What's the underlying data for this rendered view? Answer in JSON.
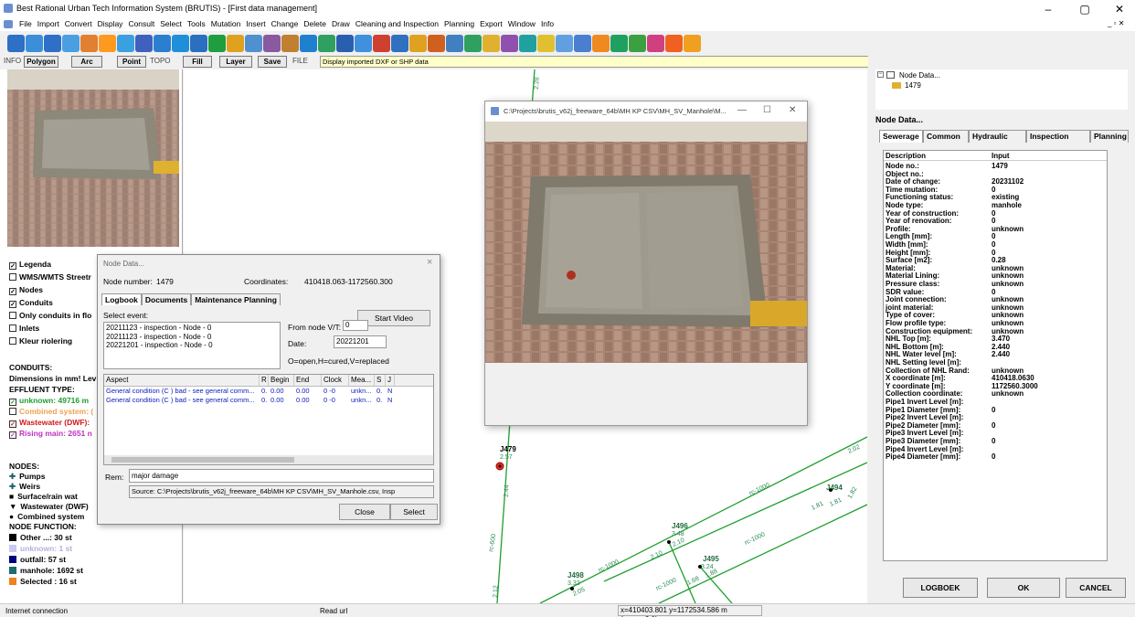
{
  "window": {
    "title": "Best Rational Urban Tech Information System (BRUTIS) - [First data management]",
    "min": "–",
    "max": "▢",
    "close": "✕"
  },
  "menu": [
    "File",
    "Import",
    "Convert",
    "Display",
    "Consult",
    "Select",
    "Tools",
    "Mutation",
    "Insert",
    "Change",
    "Delete",
    "Draw",
    "Cleaning and Inspection",
    "Planning",
    "Export",
    "Window",
    "Info"
  ],
  "toolbar2": {
    "info": "INFO",
    "polygon": "Polygon",
    "arc": "Arc",
    "point": "Point",
    "topo": "TOPO",
    "fill": "Fill",
    "layer": "Layer",
    "save": "Save",
    "file": "FILE",
    "status_text": "Display imported DXF or SHP data"
  },
  "left_panel": {
    "layers": [
      {
        "label": "Legenda",
        "checked": true
      },
      {
        "label": "WMS/WMTS Streetr",
        "checked": false
      },
      {
        "label": "Nodes",
        "checked": true
      },
      {
        "label": "Conduits",
        "checked": true
      },
      {
        "label": "Only conduits in flo",
        "checked": false
      },
      {
        "label": "Inlets",
        "checked": false
      },
      {
        "label": "Kleur riolering",
        "checked": false
      }
    ],
    "conduits_header": "CONDUITS:",
    "dims_text": "Dimensions in mm! Lev",
    "effluent_header": "EFFLUENT TYPE:",
    "effluent": [
      {
        "label": "unknown: 49716 m",
        "checked": true,
        "color": "#1f9e2f"
      },
      {
        "label": "Combined system: (",
        "checked": false,
        "color": "#f0a050"
      },
      {
        "label": "Wastewater (DWF):",
        "checked": true,
        "color": "#d01818"
      },
      {
        "label": "Rising main: 2651 n",
        "checked": true,
        "color": "#c030c0"
      }
    ],
    "nodes_header": "NODES:",
    "node_types": [
      {
        "icon": "✚",
        "label": "Pumps"
      },
      {
        "icon": "✚",
        "label": "Weirs"
      },
      {
        "icon": "■",
        "label": "Surface/rain wat"
      },
      {
        "icon": "▼",
        "label": "Wastewater (DWF)"
      },
      {
        "icon": "●",
        "label": "Combined system"
      }
    ],
    "node_function_header": "NODE FUNCTION:",
    "node_functions": [
      {
        "label": "Other ...: 30 st",
        "color": "#000000",
        "text_color": "#000000"
      },
      {
        "label": "unknown: 1 st",
        "color": "#c8c8f0",
        "text_color": "#b0b0e0"
      },
      {
        "label": "outfall: 57 st",
        "color": "#000080",
        "text_color": "#000000"
      },
      {
        "label": "manhole: 1692 st",
        "color": "#1f6c6c",
        "text_color": "#000000"
      },
      {
        "label": "Selected        : 16 st",
        "color": "#f08020",
        "text_color": "#000000"
      }
    ]
  },
  "map": {
    "labels": {
      "top_pipe": "2.28",
      "j479": "J479",
      "j479_num": "2.57",
      "pipe_a": "2.44",
      "rc600": "rc-600",
      "pipe_b": "2.12",
      "j496": "J496",
      "j496_n1": "3.48",
      "j496_n2": "2.10",
      "j495": "J495",
      "j495_n1": "3.24",
      "j495_n2": "1.88",
      "j498": "J498",
      "j498_n1": "3.32",
      "j498_n2": "2.05",
      "j494": "J494",
      "j494_n1": "1.81",
      "j494_n2": "1.82",
      "rc1000_a": "rc-1000",
      "rc1000_b": "rc-1000",
      "rc1000_c": "rc-1000",
      "rc1000_d": "rc-1000",
      "n210": "2.10",
      "n168": "1.68",
      "n181": "1.81",
      "n202": "2.02",
      "n190": "1.90"
    }
  },
  "node_dialog": {
    "title": "Node Data...",
    "node_number_label": "Node number:",
    "node_number": "1479",
    "coords_label": "Coordinates:",
    "coords": "410418.063-1172560.300",
    "tabs": [
      "Logbook",
      "Documents",
      "Maintenance Planning"
    ],
    "select_event": "Select event:",
    "events": [
      "20211123 - inspection - Node - 0",
      "20211123 - inspection - Node - 0",
      "20221201 - inspection - Node - 0"
    ],
    "start_video": "Start Video",
    "from_node_label": "From node V/T:",
    "from_node_value": "0",
    "date_label": "Date:",
    "date_value": "20221201",
    "legend": "O=open,H=cured,V=replaced",
    "columns": [
      "Aspect",
      "R",
      "Begin",
      "End",
      "Clock",
      "Mea...",
      "S",
      "J"
    ],
    "rows": [
      [
        "General condition (C ) bad - see general comm...",
        "0.",
        "0.00",
        "0.00",
        "0 -0",
        "unkn...",
        "0.",
        "N"
      ],
      [
        "General condition (C ) bad - see general comm...",
        "0.",
        "0.00",
        "0.00",
        "0 -0",
        "unkn...",
        "0.",
        "N"
      ]
    ],
    "rem_label": "Rem:",
    "rem_value": "major damage",
    "source": "Source:  C:\\Projects\\brutis_v62j_freeware_64b\\MH KP CSV\\MH_SV_Manhole.csv, Insp",
    "close_btn": "Close",
    "select_btn": "Select"
  },
  "photo_window": {
    "title": "C:\\Projects\\brutis_v62j_freeware_64b\\MH KP CSV\\MH_SV_Manhole\\M...",
    "min": "—",
    "max": "☐",
    "close": "✕"
  },
  "right_panel": {
    "tree_root": "Node Data...",
    "tree_child": "1479",
    "heading": "Node Data...",
    "tabs": [
      "Sewerage",
      "Common",
      "Hydraulic",
      "Inspection",
      "Planning"
    ],
    "col_desc": "Description",
    "col_input": "Input",
    "props": [
      [
        "Node no.:",
        "1479"
      ],
      [
        "Object no.:",
        ""
      ],
      [
        "Date of change:",
        "20231102"
      ],
      [
        "Time mutation:",
        "0"
      ],
      [
        "Functioning status:",
        "existing"
      ],
      [
        "Node type:",
        "manhole"
      ],
      [
        "Year of construction:",
        "0"
      ],
      [
        "Year of renovation:",
        "0"
      ],
      [
        "Profile:",
        "unknown"
      ],
      [
        "Length [mm]:",
        "0"
      ],
      [
        "Width [mm]:",
        "0"
      ],
      [
        "Height [mm]:",
        "0"
      ],
      [
        "Surface [m2]:",
        "0.28"
      ],
      [
        "Material:",
        "unknown"
      ],
      [
        "Material Lining:",
        "unknown"
      ],
      [
        "Pressure class:",
        "unknown"
      ],
      [
        "SDR value:",
        "0"
      ],
      [
        "Joint connection:",
        "unknown"
      ],
      [
        "joint material:",
        "unknown"
      ],
      [
        "Type of cover:",
        "unknown"
      ],
      [
        "Flow profile type:",
        "unknown"
      ],
      [
        "Construction equipment:",
        "unknown"
      ],
      [
        "NHL Top [m]:",
        "3.470"
      ],
      [
        "NHL Bottom [m]:",
        "2.440"
      ],
      [
        "NHL Water level [m]:",
        "2.440"
      ],
      [
        "NHL Setting level [m]:",
        ""
      ],
      [
        "Collection of NHL Rand:",
        "unknown"
      ],
      [
        "X coordinate [m]:",
        "410418.0630"
      ],
      [
        "Y coordinate [m]:",
        "1172560.3000"
      ],
      [
        "Collection coordinate:",
        "unknown"
      ],
      [
        "Pipe1 Invert Level [m]:",
        ""
      ],
      [
        "Pipe1 Diameter [mm]:",
        "0"
      ],
      [
        "Pipe2 Invert Level [m]:",
        ""
      ],
      [
        "Pipe2 Diameter [mm]:",
        "0"
      ],
      [
        "Pipe3 Invert Level [m]:",
        ""
      ],
      [
        "Pipe3 Diameter [mm]:",
        "0"
      ],
      [
        "Pipe4 Invert Level [m]:",
        ""
      ],
      [
        "Pipe4 Diameter [mm]:",
        "0"
      ]
    ],
    "btn_logboek": "LOGBOEK",
    "btn_ok": "OK",
    "btn_cancel": "CANCEL"
  },
  "statusbar": {
    "left": "Internet connection",
    "middle": "Read url",
    "coords": "x=410403.801 y=1172534.586 m (zoom=0.1)"
  }
}
